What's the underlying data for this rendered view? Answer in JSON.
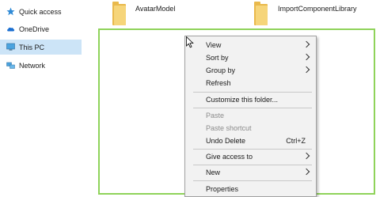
{
  "sidebar": {
    "items": [
      {
        "label": "Quick access",
        "icon": "star-icon"
      },
      {
        "label": "OneDrive",
        "icon": "cloud-icon"
      },
      {
        "label": "This PC",
        "icon": "monitor-icon",
        "selected": true
      },
      {
        "label": "Network",
        "icon": "network-icon"
      }
    ]
  },
  "content": {
    "folders": [
      {
        "name": "AvatarModel"
      },
      {
        "name": "ImportComponentLibrary"
      }
    ]
  },
  "context_menu": {
    "items": [
      {
        "label": "View",
        "submenu": true
      },
      {
        "label": "Sort by",
        "submenu": true
      },
      {
        "label": "Group by",
        "submenu": true
      },
      {
        "label": "Refresh"
      },
      {
        "label": "Customize this folder..."
      },
      {
        "label": "Paste",
        "disabled": true
      },
      {
        "label": "Paste shortcut",
        "disabled": true
      },
      {
        "label": "Undo Delete",
        "shortcut": "Ctrl+Z"
      },
      {
        "label": "Give access to",
        "submenu": true
      },
      {
        "label": "New",
        "submenu": true
      },
      {
        "label": "Properties"
      }
    ]
  },
  "colors": {
    "selection_border": "#8fd35a",
    "nav_selected": "#cce4f7",
    "folder": "#f6d57a"
  }
}
